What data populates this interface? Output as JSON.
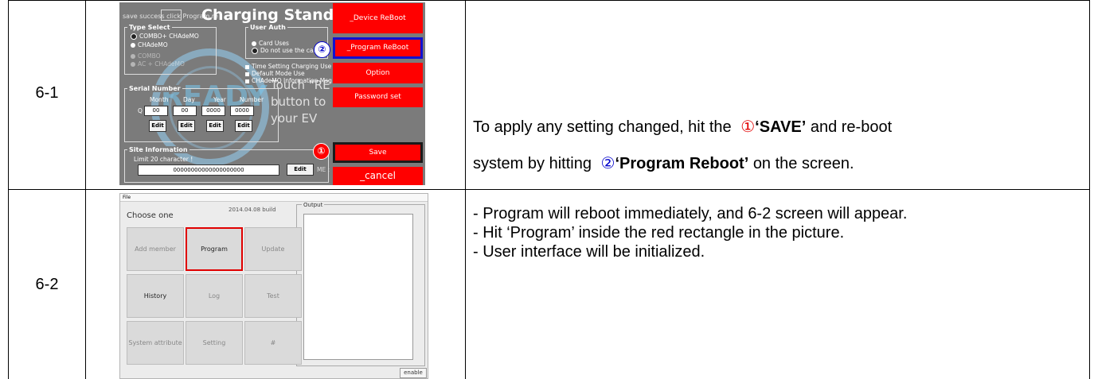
{
  "rows": [
    {
      "label": "6-1"
    },
    {
      "label": "6-2"
    }
  ],
  "row1_desc": {
    "line1_prefix": "To apply any setting changed, hit the",
    "circled1": "①",
    "save": "‘SAVE’",
    "line1_suffix": "and re-boot",
    "line2_prefix": "system by hitting",
    "circled2": "②",
    "program_reboot": "‘Program Reboot’",
    "line2_suffix": "on the screen."
  },
  "row2_desc": {
    "bullets": [
      "- Program will reboot immediately, and 6-2 screen will appear.",
      "- Hit ‘Program’ inside the red rectangle in the picture.",
      "- User interface will be initialized."
    ]
  },
  "shot1": {
    "title": "Charging Stand-by",
    "top_small": "save success click   Program re",
    "type_select": "Type Select",
    "type_opts": [
      "COMBO+ CHAdeMO",
      "CHAdeMO",
      "COMBO",
      "AC + CHAdeMO"
    ],
    "user_auth": "User Auth",
    "auth_opts": [
      "Card Uses",
      "Do not use the card"
    ],
    "checks": [
      "Time Setting Charging Use",
      "Default Mode Use",
      "CHAdeMO Information Msg"
    ],
    "serial_number": "Serial Number",
    "serial_headers": [
      "Month",
      "Day",
      "Year",
      "Number"
    ],
    "serial_prefix": "Q",
    "serial_values": [
      "00",
      "00",
      "0000",
      "0000"
    ],
    "edit": "Edit",
    "site_information": "Site Information",
    "limit": "Limit 20 character !",
    "site_value": "00000000000000000000",
    "me": "ME :",
    "ready": "READY",
    "touch1": "Touch \"RE",
    "touch2": "button to",
    "touch3": "your EV",
    "buttons": {
      "device_reboot": "_Device ReBoot",
      "program_reboot": "_Program ReBoot",
      "option": "Option",
      "password_set": "Password set",
      "save": "Save",
      "cancel": "_cancel"
    },
    "marker1": "①",
    "marker2": "②"
  },
  "shot2": {
    "file": "File",
    "choose_one": "Choose one",
    "build": "2014.04.08 build",
    "output": "Output",
    "buttons": [
      [
        "Add member",
        "Program",
        "Update"
      ],
      [
        "History",
        "Log",
        "Test"
      ],
      [
        "System attribute",
        "Setting",
        "#"
      ]
    ],
    "enable": "enable"
  },
  "colors": {
    "red_button": "#ff0000",
    "screen_bg": "#7b7b7b",
    "circled_red": "#e30000",
    "circled_blue": "#0000cc"
  }
}
